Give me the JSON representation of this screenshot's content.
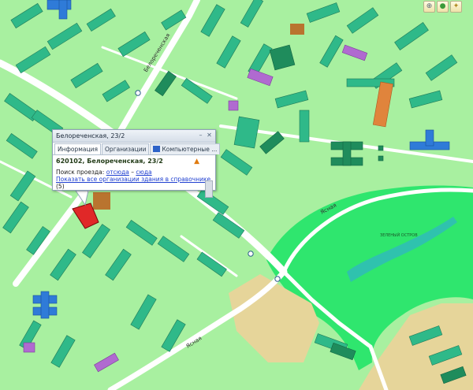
{
  "map": {
    "street_belorechenskaya": "Белореченская",
    "street_yasnaya_1": "Ясная",
    "street_yasnaya_2": "Ясная",
    "park_label": "ЗЕЛЕНЫЙ ОСТРОВ"
  },
  "toolbar": {
    "icons": [
      "zoom-in-icon",
      "layers-icon",
      "settings-icon"
    ]
  },
  "popup": {
    "title": "Белореченская, 23/2",
    "tabs": [
      "Информация",
      "Организации",
      "Компьютерные ..."
    ],
    "address": "620102, Белореченская, 23/2",
    "route_label": "Поиск проезда:",
    "route_from": "отсюда",
    "route_sep": " – ",
    "route_to": "сюда",
    "show_all_link": "Показать все организации здания в справочнике",
    "show_all_count": "(5)"
  },
  "colors": {
    "map_background": "#a8f0a0",
    "road": "#ffffff",
    "building": "#2fb989",
    "park": "#2fe66e",
    "selected_building": "#e02828"
  }
}
